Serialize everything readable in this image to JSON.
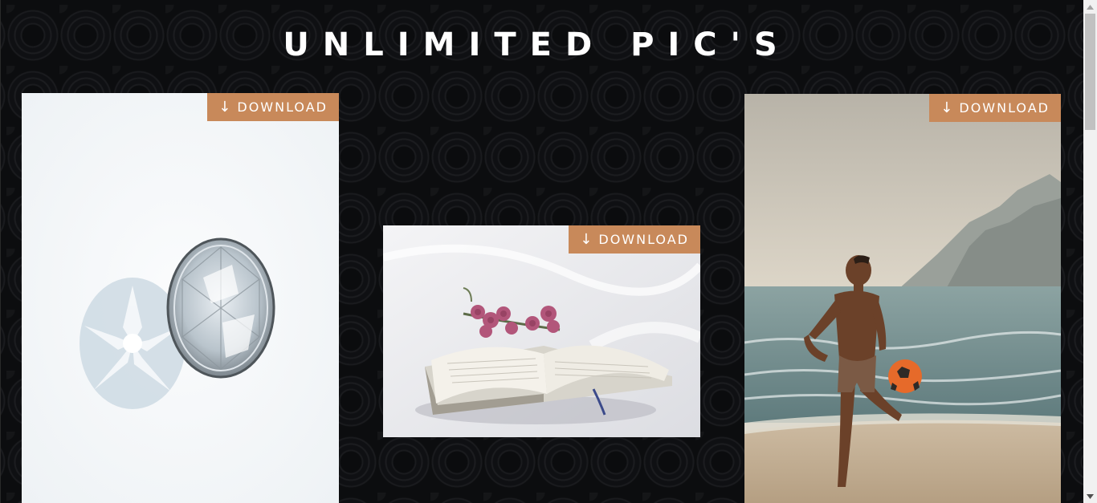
{
  "page": {
    "title": "UNLIMITED PIC'S"
  },
  "cards": [
    {
      "download_arrow": "↓",
      "download_label": "DOWNLOAD",
      "image_subject": "diamond"
    },
    {
      "download_arrow": "↓",
      "download_label": "DOWNLOAD",
      "image_subject": "book-with-roses"
    },
    {
      "download_arrow": "↓",
      "download_label": "DOWNLOAD",
      "image_subject": "man-kicking-ball-on-beach"
    }
  ],
  "colors": {
    "background": "#0c0d0f",
    "title": "#ffffff",
    "download_button": "#c8895a",
    "download_text": "#ffffff",
    "scrollbar_track": "#f1f1f1",
    "scrollbar_thumb": "#c1c1c1"
  },
  "icons": {
    "download": "down-arrow-icon",
    "scroll_up": "triangle-up-icon",
    "scroll_down": "triangle-down-icon"
  }
}
